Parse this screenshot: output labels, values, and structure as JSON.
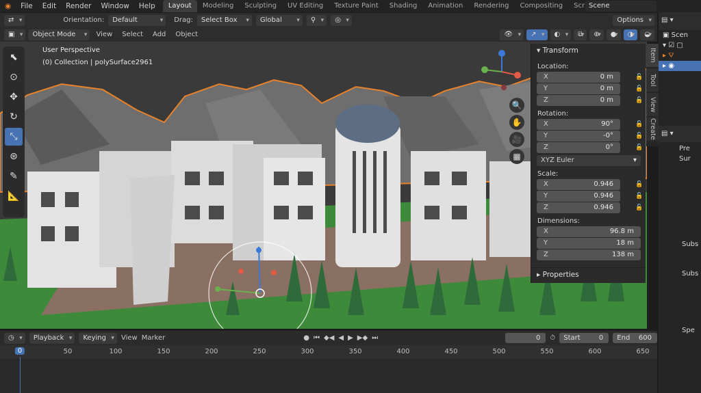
{
  "app": {
    "menus": [
      "File",
      "Edit",
      "Render",
      "Window",
      "Help"
    ],
    "workspaces": [
      "Layout",
      "Modeling",
      "Sculpting",
      "UV Editing",
      "Texture Paint",
      "Shading",
      "Animation",
      "Rendering",
      "Compositing",
      "Scripting"
    ],
    "active_workspace": "Layout",
    "scene": "Scene"
  },
  "header": {
    "orientation_label": "Orientation:",
    "orientation_value": "Default",
    "drag_label": "Drag:",
    "drag_value": "Select Box",
    "transform_orientation": "Global",
    "options": "Options"
  },
  "viewport_header": {
    "mode": "Object Mode",
    "menus": [
      "View",
      "Select",
      "Add",
      "Object"
    ]
  },
  "viewport": {
    "perspective": "User Perspective",
    "collection": "(0) Collection | polySurface2961"
  },
  "npanel": {
    "title": "Transform",
    "location_label": "Location:",
    "location": [
      {
        "k": "X",
        "v": "0 m"
      },
      {
        "k": "Y",
        "v": "0 m"
      },
      {
        "k": "Z",
        "v": "0 m"
      }
    ],
    "rotation_label": "Rotation:",
    "rotation": [
      {
        "k": "X",
        "v": "90°"
      },
      {
        "k": "Y",
        "v": "-0°"
      },
      {
        "k": "Z",
        "v": "0°"
      }
    ],
    "rotation_mode": "XYZ Euler",
    "scale_label": "Scale:",
    "scale": [
      {
        "k": "X",
        "v": "0.946"
      },
      {
        "k": "Y",
        "v": "0.946"
      },
      {
        "k": "Z",
        "v": "0.946"
      }
    ],
    "dimensions_label": "Dimensions:",
    "dimensions": [
      {
        "k": "X",
        "v": "96.8 m"
      },
      {
        "k": "Y",
        "v": "18 m"
      },
      {
        "k": "Z",
        "v": "138 m"
      }
    ],
    "properties": "Properties",
    "side_tabs": [
      "Item",
      "Tool",
      "View",
      "Create"
    ]
  },
  "outliner": {
    "scene_label": "Scen"
  },
  "properties_editor": {
    "labels": [
      "Pre",
      "Sur",
      "Subs",
      "Subs",
      "Spe"
    ]
  },
  "timeline": {
    "menus": [
      "Playback",
      "Keying",
      "View",
      "Marker"
    ],
    "current_frame": "0",
    "start_label": "Start",
    "start": "0",
    "end_label": "End",
    "end": "600",
    "ticks": [
      "0",
      "50",
      "100",
      "150",
      "200",
      "250",
      "300",
      "350",
      "400",
      "450",
      "500",
      "550",
      "600",
      "650"
    ]
  },
  "colors": {
    "accent": "#4772b3",
    "selection_outline": "#e8822a",
    "grass": "#3d8a3a"
  }
}
